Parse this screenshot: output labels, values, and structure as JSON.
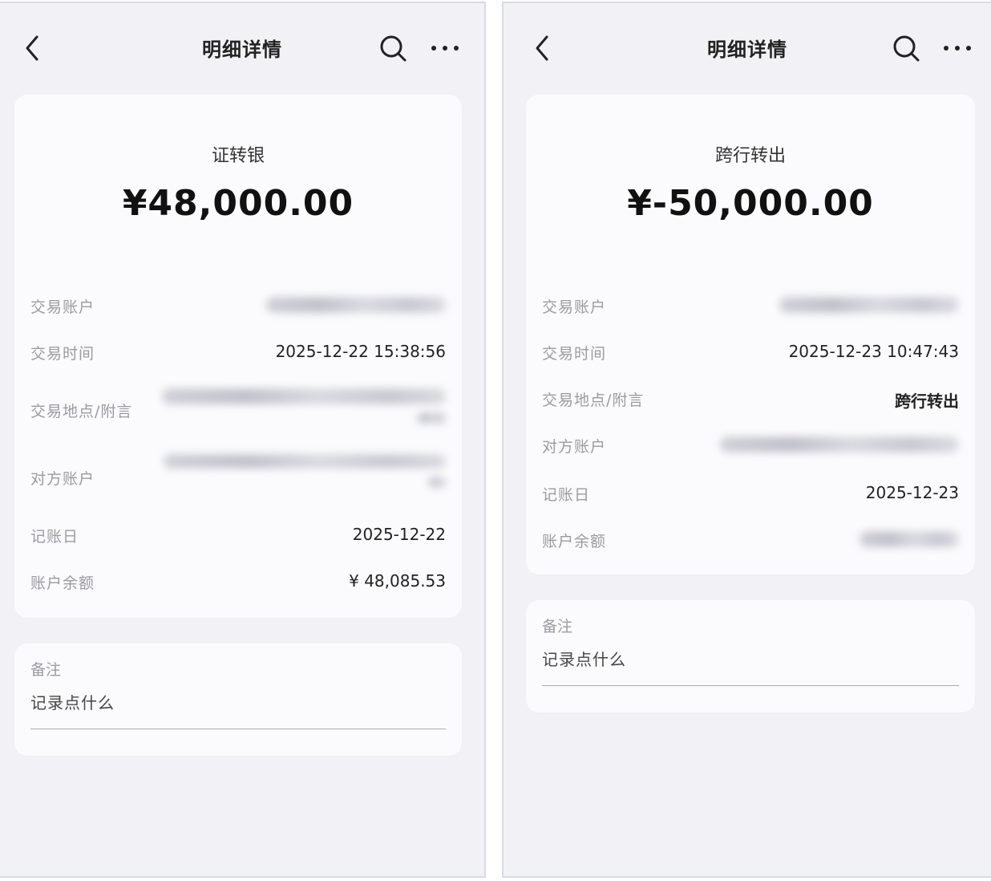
{
  "left": {
    "header": {
      "title": "明细详情",
      "back_icon": "chevron-left-icon",
      "search_icon": "search-icon",
      "more_icon": "more-horizontal-icon"
    },
    "summary": {
      "type": "证转银",
      "amount": "¥48,000.00"
    },
    "rows": [
      {
        "label": "交易账户",
        "value": ""
      },
      {
        "label": "交易时间",
        "value": "2025-12-22 15:38:56"
      },
      {
        "label": "交易地点/附言",
        "value": ""
      },
      {
        "label": "对方账户",
        "value": ""
      },
      {
        "label": "记账日",
        "value": "2025-12-22"
      },
      {
        "label": "账户余额",
        "value": "¥ 48,085.53"
      }
    ],
    "note": {
      "label": "备注",
      "placeholder": "记录点什么"
    }
  },
  "right": {
    "header": {
      "title": "明细详情",
      "back_icon": "chevron-left-icon",
      "search_icon": "search-icon",
      "more_icon": "more-horizontal-icon"
    },
    "summary": {
      "type": "跨行转出",
      "amount": "¥-50,000.00"
    },
    "rows": [
      {
        "label": "交易账户",
        "value": ""
      },
      {
        "label": "交易时间",
        "value": "2025-12-23 10:47:43"
      },
      {
        "label": "交易地点/附言",
        "value": "跨行转出"
      },
      {
        "label": "对方账户",
        "value": ""
      },
      {
        "label": "记账日",
        "value": "2025-12-23"
      },
      {
        "label": "账户余额",
        "value": ""
      }
    ],
    "note": {
      "label": "备注",
      "placeholder": "记录点什么"
    }
  },
  "colors": {
    "page_bg": "#f2f2f6",
    "card_bg": "#fbfbfd",
    "label": "#9a9aa2",
    "text": "#222222"
  }
}
